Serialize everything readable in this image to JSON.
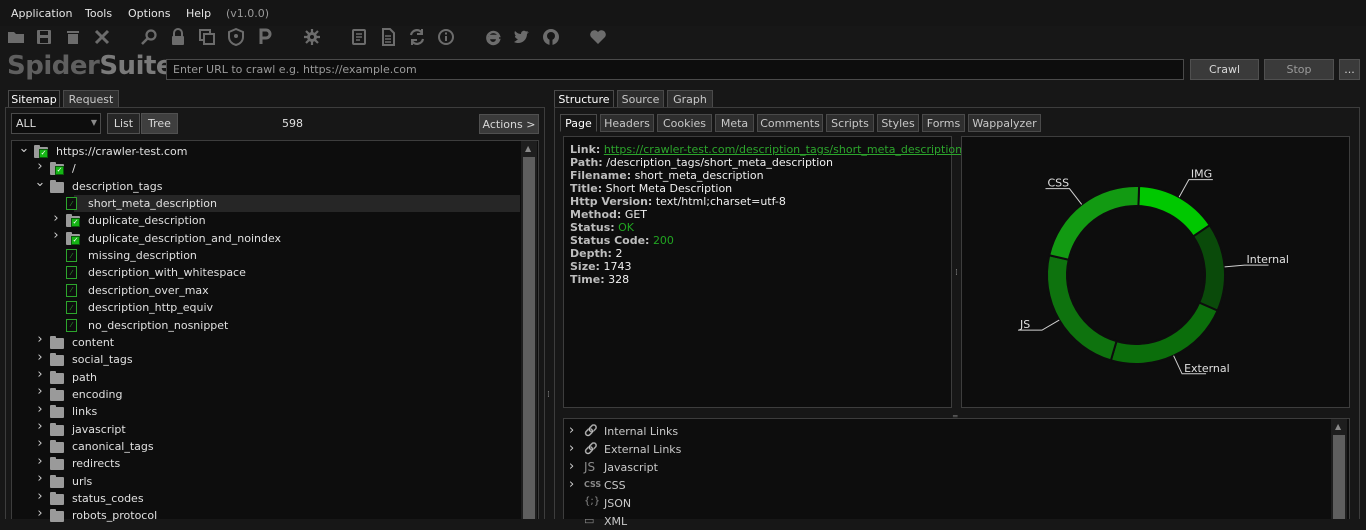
{
  "menu": {
    "items": [
      "Application",
      "Tools",
      "Options",
      "Help"
    ],
    "version": "(v1.0.0)"
  },
  "toolbar": {
    "icons": [
      "folder-icon",
      "save-icon",
      "trash-icon",
      "close-icon",
      "search-icon",
      "lock-icon",
      "copy-icon",
      "shield-icon",
      "p-icon",
      "gear-icon",
      "notes-icon",
      "document-icon",
      "sync-icon",
      "info-icon",
      "ie-icon",
      "twitter-icon",
      "github-icon",
      "heart-icon"
    ]
  },
  "logo": {
    "part1": "Spider",
    "part2": "Suite"
  },
  "url_bar": {
    "placeholder": "Enter URL to crawl e.g. https://example.com",
    "value": ""
  },
  "buttons": {
    "crawl": "Crawl",
    "stop": "Stop",
    "more": "..."
  },
  "left_tabs": [
    "Sitemap",
    "Request"
  ],
  "filter": {
    "selected": "ALL",
    "view_list": "List",
    "view_tree": "Tree",
    "count": "598",
    "actions": "Actions >"
  },
  "tree": [
    {
      "label": "https://crawler-test.com",
      "depth": 0,
      "expanded": true,
      "icon": "folder-check"
    },
    {
      "label": "/",
      "depth": 1,
      "expanded": false,
      "icon": "folder-check"
    },
    {
      "label": "description_tags",
      "depth": 1,
      "expanded": true,
      "icon": "folder"
    },
    {
      "label": "short_meta_description",
      "depth": 2,
      "expanded": null,
      "icon": "page",
      "selected": true
    },
    {
      "label": "duplicate_description",
      "depth": 2,
      "expanded": false,
      "icon": "folder-check"
    },
    {
      "label": "duplicate_description_and_noindex",
      "depth": 2,
      "expanded": false,
      "icon": "folder-check"
    },
    {
      "label": "missing_description",
      "depth": 2,
      "expanded": null,
      "icon": "page"
    },
    {
      "label": "description_with_whitespace",
      "depth": 2,
      "expanded": null,
      "icon": "page"
    },
    {
      "label": "description_over_max",
      "depth": 2,
      "expanded": null,
      "icon": "page"
    },
    {
      "label": "description_http_equiv",
      "depth": 2,
      "expanded": null,
      "icon": "page"
    },
    {
      "label": "no_description_nosnippet",
      "depth": 2,
      "expanded": null,
      "icon": "page"
    },
    {
      "label": "content",
      "depth": 1,
      "expanded": false,
      "icon": "folder"
    },
    {
      "label": "social_tags",
      "depth": 1,
      "expanded": false,
      "icon": "folder"
    },
    {
      "label": "path",
      "depth": 1,
      "expanded": false,
      "icon": "folder"
    },
    {
      "label": "encoding",
      "depth": 1,
      "expanded": false,
      "icon": "folder"
    },
    {
      "label": "links",
      "depth": 1,
      "expanded": false,
      "icon": "folder"
    },
    {
      "label": "javascript",
      "depth": 1,
      "expanded": false,
      "icon": "folder"
    },
    {
      "label": "canonical_tags",
      "depth": 1,
      "expanded": false,
      "icon": "folder"
    },
    {
      "label": "redirects",
      "depth": 1,
      "expanded": false,
      "icon": "folder"
    },
    {
      "label": "urls",
      "depth": 1,
      "expanded": false,
      "icon": "folder"
    },
    {
      "label": "status_codes",
      "depth": 1,
      "expanded": false,
      "icon": "folder"
    },
    {
      "label": "robots_protocol",
      "depth": 1,
      "expanded": false,
      "icon": "folder"
    }
  ],
  "right_tabs": [
    "Structure",
    "Source",
    "Graph"
  ],
  "sub_tabs": [
    "Page",
    "Headers",
    "Cookies",
    "Meta",
    "Comments",
    "Scripts",
    "Styles",
    "Forms",
    "Wappalyzer"
  ],
  "page_info": [
    {
      "key": "Link:",
      "value": "https://crawler-test.com/description_tags/short_meta_description",
      "style": "link"
    },
    {
      "key": "Path:",
      "value": "/description_tags/short_meta_description",
      "style": "plain"
    },
    {
      "key": "Filename:",
      "value": "short_meta_description",
      "style": "plain"
    },
    {
      "key": "Title:",
      "value": "Short Meta Description",
      "style": "plain"
    },
    {
      "key": "Http Version:",
      "value": "text/html;charset=utf-8",
      "style": "plain"
    },
    {
      "key": "Method:",
      "value": "GET",
      "style": "plain"
    },
    {
      "key": "Status:",
      "value": "OK",
      "style": "ok"
    },
    {
      "key": "Status Code:",
      "value": "200",
      "style": "ok"
    },
    {
      "key": "Depth:",
      "value": "2",
      "style": "plain"
    },
    {
      "key": "Size:",
      "value": "1743",
      "style": "plain"
    },
    {
      "key": "Time:",
      "value": "328",
      "style": "plain"
    }
  ],
  "chart_data": {
    "type": "pie",
    "donut": true,
    "categories": [
      "IMG",
      "Internal",
      "External",
      "JS",
      "CSS"
    ],
    "values": [
      15,
      16,
      23,
      24,
      22
    ],
    "colors": [
      "#00c800",
      "#0a4a0a",
      "#0b6e0b",
      "#0e730e",
      "#129a12"
    ]
  },
  "resources": [
    {
      "label": "Internal Links",
      "icon": "link-icon",
      "expandable": true
    },
    {
      "label": "External Links",
      "icon": "link-icon",
      "expandable": true
    },
    {
      "label": "Javascript",
      "icon": "js-icon",
      "expandable": true
    },
    {
      "label": "CSS",
      "icon": "css-icon",
      "expandable": true
    },
    {
      "label": "JSON",
      "icon": "json-icon",
      "expandable": false
    },
    {
      "label": "XML",
      "icon": "xml-icon",
      "expandable": false
    }
  ],
  "resource_icon_glyphs": {
    "link-icon": "🔗",
    "js-icon": "JS",
    "css-icon": "CSS",
    "json-icon": "{;}",
    "xml-icon": "▭"
  }
}
